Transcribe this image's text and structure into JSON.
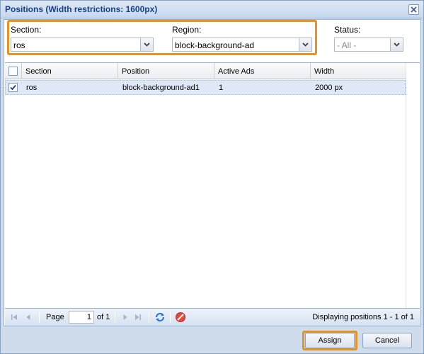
{
  "window": {
    "title": "Positions (Width restrictions: 1600px)",
    "close_icon": "close-icon"
  },
  "filters": {
    "section_label": "Section:",
    "section_value": "ros",
    "region_label": "Region:",
    "region_value": "block-background-ad",
    "status_label": "Status:",
    "status_value": "- All -",
    "highlight_color": "#e8921f"
  },
  "grid": {
    "columns": [
      "Section",
      "Position",
      "Active Ads",
      "Width"
    ],
    "rows": [
      {
        "checked": true,
        "section": "ros",
        "position": "block-background-ad1",
        "active_ads": "1",
        "width": "2000 px"
      }
    ],
    "selected_row_color": "#dfe8f6"
  },
  "pager": {
    "page_label": "Page",
    "page_value": "1",
    "of_label": "of 1",
    "status_text": "Displaying positions 1 - 1 of 1",
    "icons": [
      "first-page-icon",
      "prev-page-icon",
      "next-page-icon",
      "last-page-icon",
      "refresh-icon",
      "clear-filter-icon"
    ]
  },
  "footer": {
    "assign_label": "Assign",
    "cancel_label": "Cancel"
  }
}
